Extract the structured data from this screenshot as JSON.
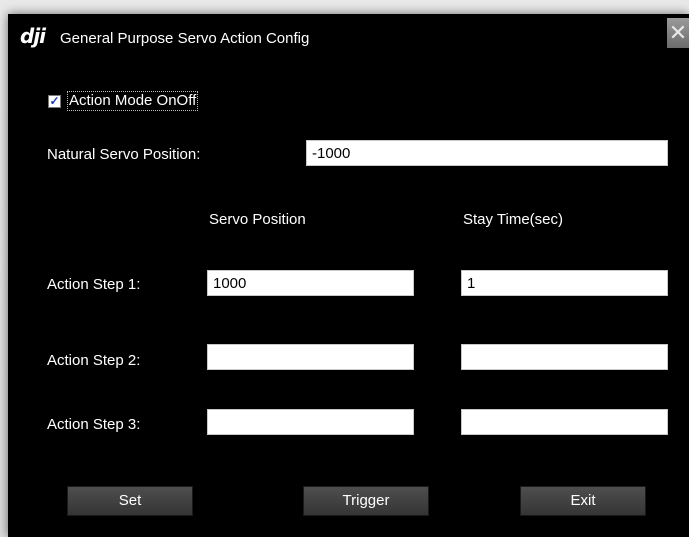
{
  "window": {
    "logo": "dji",
    "title": "General Purpose Servo Action Config",
    "close_icon": "close-icon"
  },
  "action_mode": {
    "label": "Action Mode OnOff",
    "checked": true,
    "check_mark": "✓"
  },
  "natural": {
    "label": "Natural Servo Position:",
    "value": "-1000"
  },
  "headers": {
    "servo_position": "Servo Position",
    "stay_time": "Stay Time(sec)"
  },
  "steps": [
    {
      "label": "Action Step 1:",
      "servo_position": "1000",
      "stay_time": "1"
    },
    {
      "label": "Action Step 2:",
      "servo_position": "",
      "stay_time": ""
    },
    {
      "label": "Action Step 3:",
      "servo_position": "",
      "stay_time": ""
    }
  ],
  "buttons": {
    "set": "Set",
    "trigger": "Trigger",
    "exit": "Exit"
  },
  "colors": {
    "background": "#000000",
    "text": "#ffffff",
    "button": "#444444"
  }
}
